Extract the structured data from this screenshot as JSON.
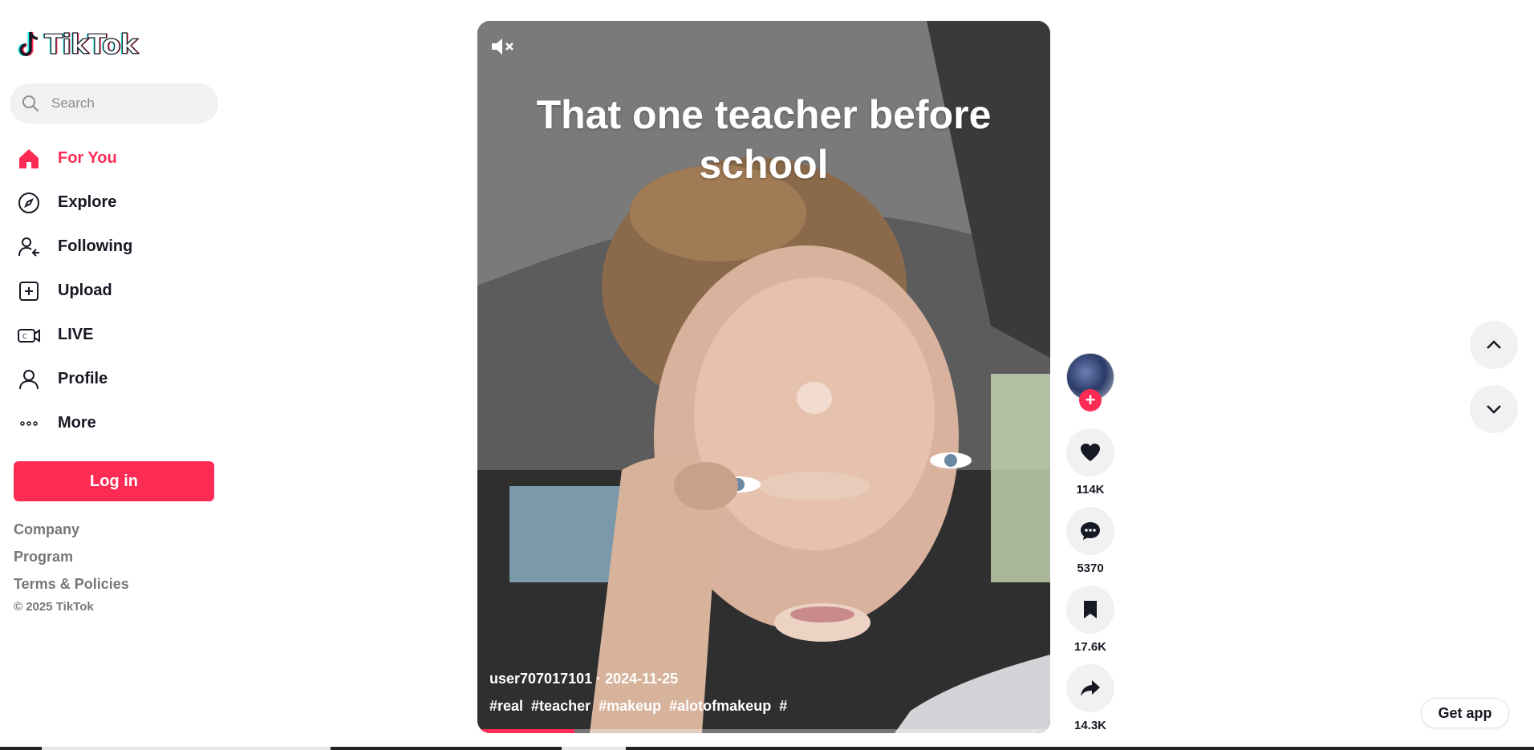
{
  "app": {
    "logo_text": "TikTok"
  },
  "search": {
    "placeholder": "Search"
  },
  "nav": {
    "items": [
      {
        "label": "For You",
        "icon": "home-icon",
        "active": true
      },
      {
        "label": "Explore",
        "icon": "compass-icon"
      },
      {
        "label": "Following",
        "icon": "following-icon"
      },
      {
        "label": "Upload",
        "icon": "upload-icon"
      },
      {
        "label": "LIVE",
        "icon": "live-icon"
      },
      {
        "label": "Profile",
        "icon": "profile-icon"
      },
      {
        "label": "More",
        "icon": "more-icon"
      }
    ]
  },
  "login": {
    "label": "Log in"
  },
  "footer": {
    "links": [
      "Company",
      "Program",
      "Terms & Policies"
    ],
    "copyright": "© 2025 TikTok"
  },
  "video": {
    "caption": "That one teacher before school",
    "author_date": "user707017101 · 2024-11-25",
    "tags": [
      "#real",
      "#teacher",
      "#makeup",
      "#alotofmakeup",
      "#"
    ],
    "progress_fraction": 0.17,
    "muted": true
  },
  "actions": {
    "likes": "114K",
    "comments": "5370",
    "saves": "17.6K",
    "shares": "14.3K"
  },
  "get_app": {
    "label": "Get app"
  },
  "colors": {
    "accent": "#fe2c55",
    "text": "#161823",
    "muted": "#75767b",
    "button_bg": "#f1f1f2"
  }
}
